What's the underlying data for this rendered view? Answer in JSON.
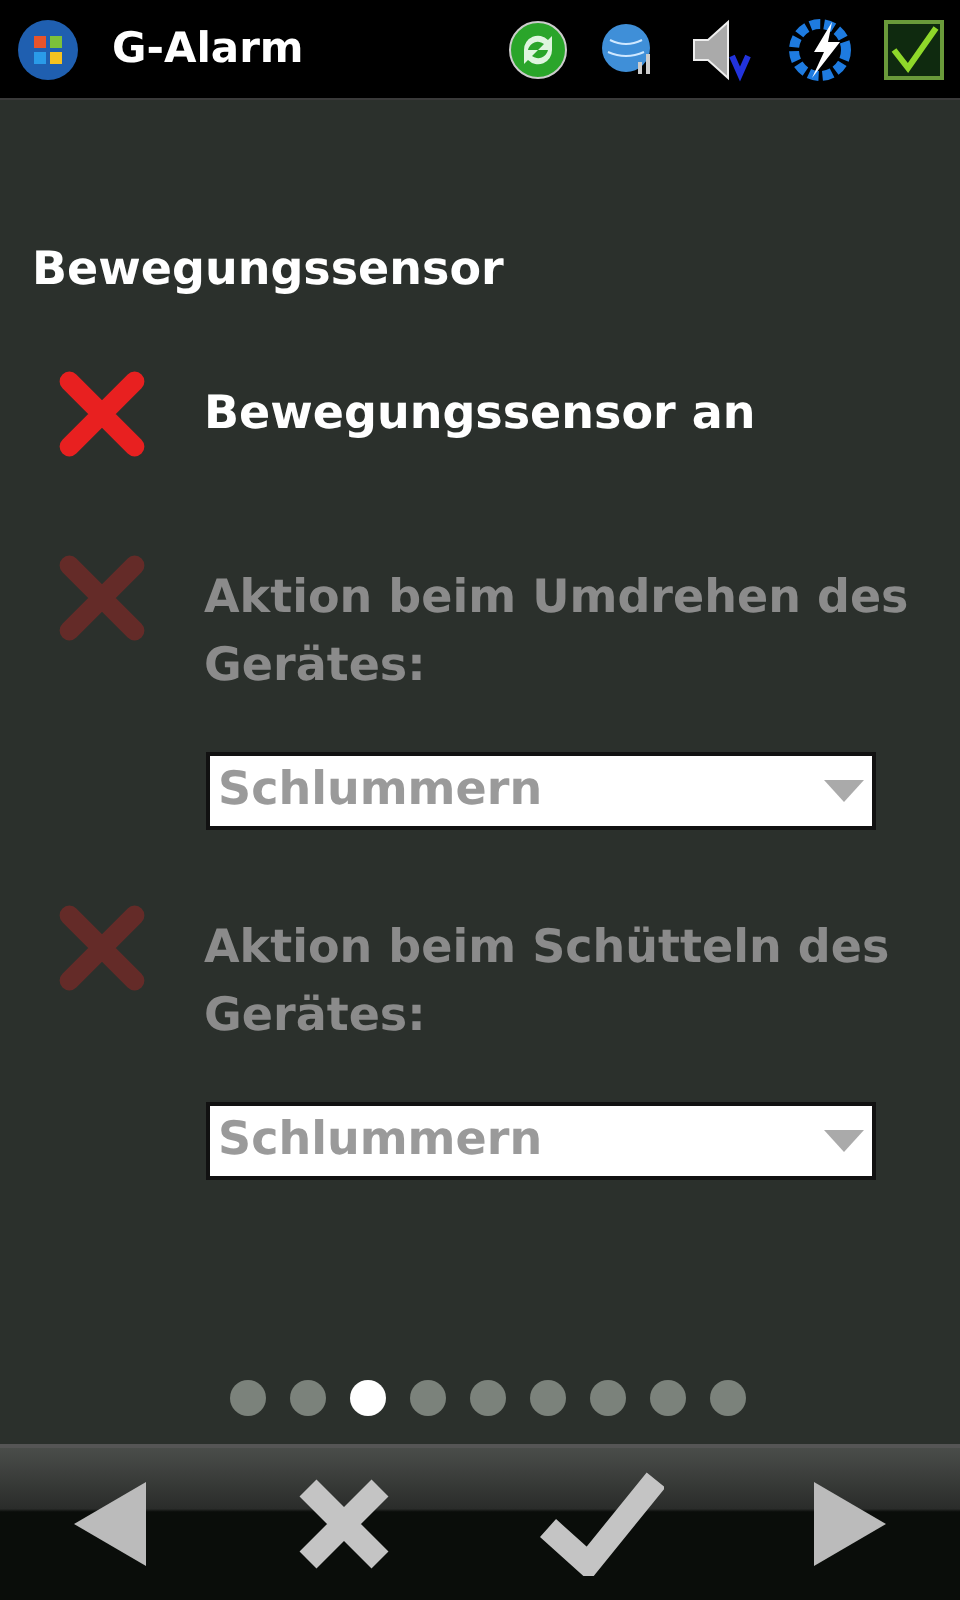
{
  "window": {
    "title": "G-Alarm"
  },
  "heading": "Bewegungssensor",
  "settings": [
    {
      "label": "Bewegungssensor an",
      "checked": false,
      "disabled": false
    },
    {
      "label": "Aktion beim Umdrehen des Gerätes:",
      "checked": false,
      "disabled": true,
      "select": {
        "value": "Schlummern",
        "disabled": true
      }
    },
    {
      "label": "Aktion beim Schütteln des Gerätes:",
      "checked": false,
      "disabled": true,
      "select": {
        "value": "Schlummern",
        "disabled": true
      }
    }
  ],
  "pages": [
    {
      "selected": false
    },
    {
      "selected": false
    },
    {
      "selected": true
    },
    {
      "selected": false
    },
    {
      "selected": false
    },
    {
      "selected": false
    },
    {
      "selected": false
    },
    {
      "selected": false
    },
    {
      "selected": false
    }
  ]
}
